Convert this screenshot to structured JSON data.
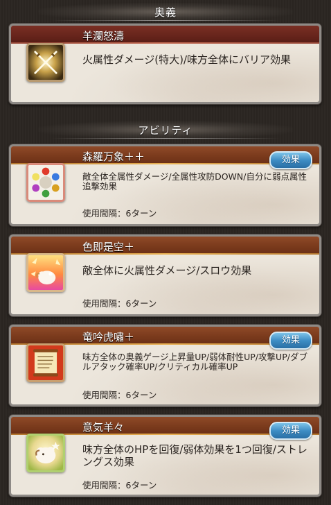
{
  "ougi_section": {
    "title": "奥義",
    "skill": {
      "name": "羊瀾怒濤",
      "description": "火属性ダメージ(特大)/味方全体にバリア効果",
      "icon": "crossed-swords-icon"
    }
  },
  "ability_section": {
    "title": "アビリティ",
    "abilities": [
      {
        "name": "森羅万象＋＋",
        "description": "敵全体全属性ダメージ/全属性攻防DOWN/自分に弱点属性追撃効果",
        "cooldown": "使用間隔：6ターン",
        "effect_label": "効果",
        "icon": "elemental-orbs-icon"
      },
      {
        "name": "色即是空＋",
        "description": "敵全体に火属性ダメージ/スロウ効果",
        "cooldown": "使用間隔：6ターン",
        "icon": "sheep-fire-icon"
      },
      {
        "name": "竜吟虎嘯＋",
        "description": "味方全体の奥義ゲージ上昇量UP/弱体耐性UP/攻撃UP/ダブルアタック確率UP/クリティカル確率UP",
        "cooldown": "使用間隔：6ターン",
        "effect_label": "効果",
        "icon": "scroll-icon"
      },
      {
        "name": "意気羊々",
        "description": "味方全体のHPを回復/弱体効果を1つ回復/ストレングス効果",
        "cooldown": "使用間隔：6ターン",
        "effect_label": "効果",
        "icon": "sheep-heal-icon"
      }
    ]
  }
}
